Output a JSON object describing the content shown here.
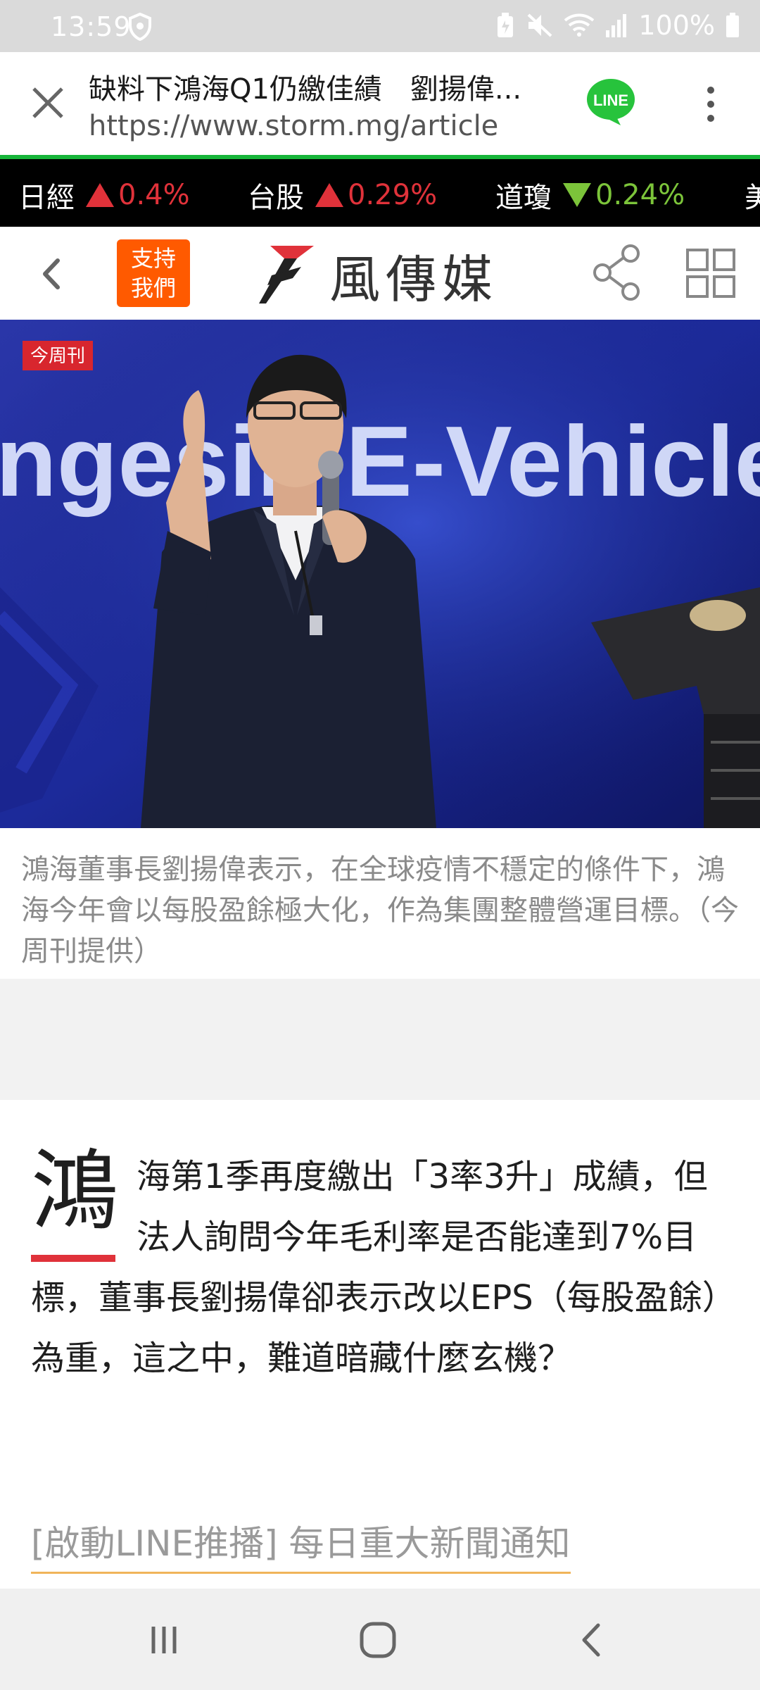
{
  "status_bar": {
    "time": "13:59",
    "battery": "100%",
    "icons": [
      "shield-icon",
      "battery-saver-icon",
      "mute-icon",
      "wifi-icon",
      "signal-icon",
      "battery-icon"
    ]
  },
  "browser": {
    "page_title": "缺料下鴻海Q1仍繳佳績　劉揚偉...",
    "url": "https://www.storm.mg/article",
    "line_label": "LINE"
  },
  "ticker": [
    {
      "name": "日經",
      "direction": "up",
      "value": "0.4%"
    },
    {
      "name": "台股",
      "direction": "up",
      "value": "0.29%"
    },
    {
      "name": "道瓊",
      "direction": "down",
      "value": "0.24%"
    },
    {
      "name": "美",
      "direction": "",
      "value": ""
    }
  ],
  "site_header": {
    "support_line1": "支持",
    "support_line2": "我們",
    "logo_text": "風傳媒"
  },
  "hero": {
    "watermark": "今周刊",
    "banner_text": "ngesin E-Vehicle"
  },
  "caption": "鴻海董事長劉揚偉表示，在全球疫情不穩定的條件下，鴻海今年會以每股盈餘極大化，作為集團整體營運目標。（今周刊提供）",
  "article": {
    "drop_cap": "鴻",
    "body": "海第1季再度繳出「3率3升」成績，但法人詢問今年毛利率是否能達到7%目標，董事長劉揚偉卻表示改以EPS（每股盈餘）為重，這之中，難道暗藏什麼玄機？"
  },
  "promo": "[啟動LINE推播] 每日重大新聞通知",
  "colors": {
    "accent_red": "#e0323a",
    "up_red": "#e0323a",
    "down_green": "#7cc43a",
    "support_orange": "#ff5a00",
    "line_green": "#17b53a"
  }
}
